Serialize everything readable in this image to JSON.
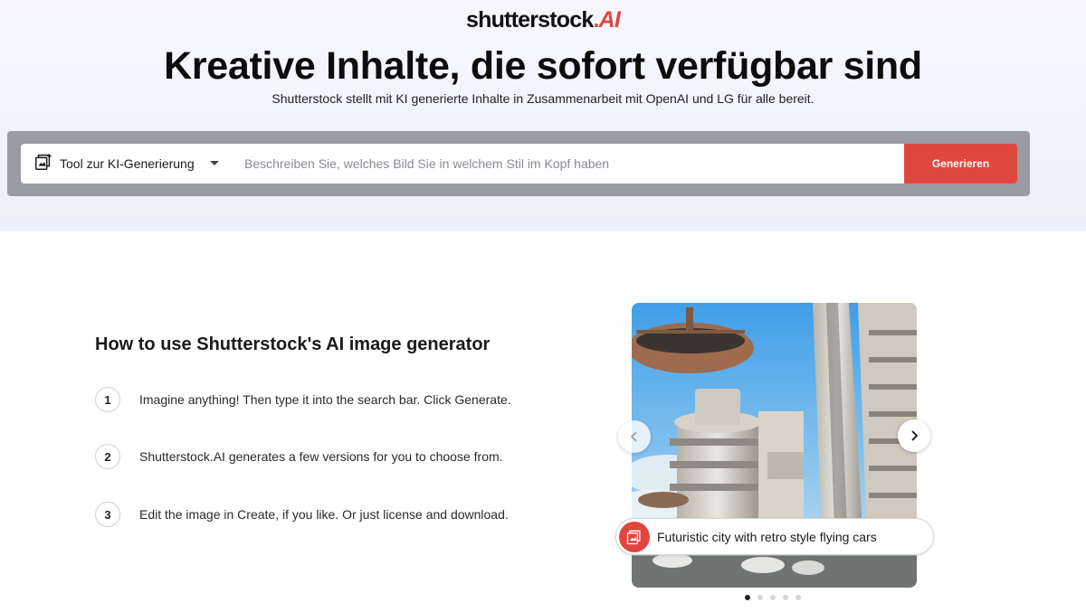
{
  "brand": {
    "name": "shutterstock",
    "dot": ".",
    "ai": "AI"
  },
  "hero": {
    "headline": "Kreative Inhalte, die sofort verfügbar sind",
    "subline": "Shutterstock stellt mit KI generierte Inhalte in Zusammenarbeit mit OpenAI und LG für alle bereit."
  },
  "search": {
    "tool_label": "Tool zur KI-Generierung",
    "placeholder": "Beschreiben Sie, welches Bild Sie in welchem Stil im Kopf haben",
    "value": "",
    "button_label": "Generieren"
  },
  "howto": {
    "title": "How to use Shutterstock's AI image generator",
    "steps": [
      {
        "num": "1",
        "text": "Imagine anything! Then type it into the search bar. Click Generate."
      },
      {
        "num": "2",
        "text": "Shutterstock.AI generates a few versions for you to choose from."
      },
      {
        "num": "3",
        "text": "Edit the image in Create, if you like. Or just license and download."
      }
    ]
  },
  "carousel": {
    "caption": "Futuristic city with retro style flying cars",
    "slide_count": 5,
    "active_slide": 1
  },
  "colors": {
    "accent": "#e0483f",
    "searchbar_frame": "#9a9ba4"
  }
}
